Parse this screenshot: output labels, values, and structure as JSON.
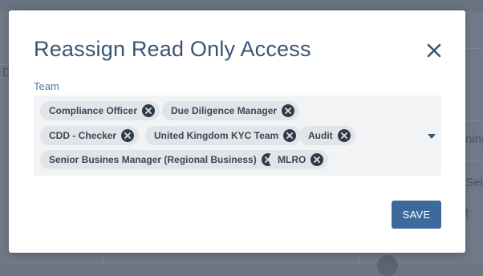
{
  "modal": {
    "title": "Reassign Read Only Access",
    "team_label": "Team",
    "save_label": "SAVE"
  },
  "team_tags": [
    "Compliance Officer",
    "Due Diligence Manager",
    "CDD - Checker",
    "United Kingdom KYC Team",
    "Audit",
    "Senior Busines Manager (Regional Business)",
    "MLRO"
  ],
  "background": {
    "fragment_left": "D",
    "fragment_right_1": "ning",
    "fragment_right_2": "Sel",
    "fragment_right_3": "t"
  },
  "icons": {
    "close": "close-icon",
    "tag_remove": "remove-circle-icon",
    "dropdown": "caret-down-icon"
  },
  "colors": {
    "title": "#3a5574",
    "label": "#4a77a8",
    "save_button": "#3d6a9c",
    "tag_bg": "#e1e4e8",
    "tag_remove": "#2f3a47"
  }
}
